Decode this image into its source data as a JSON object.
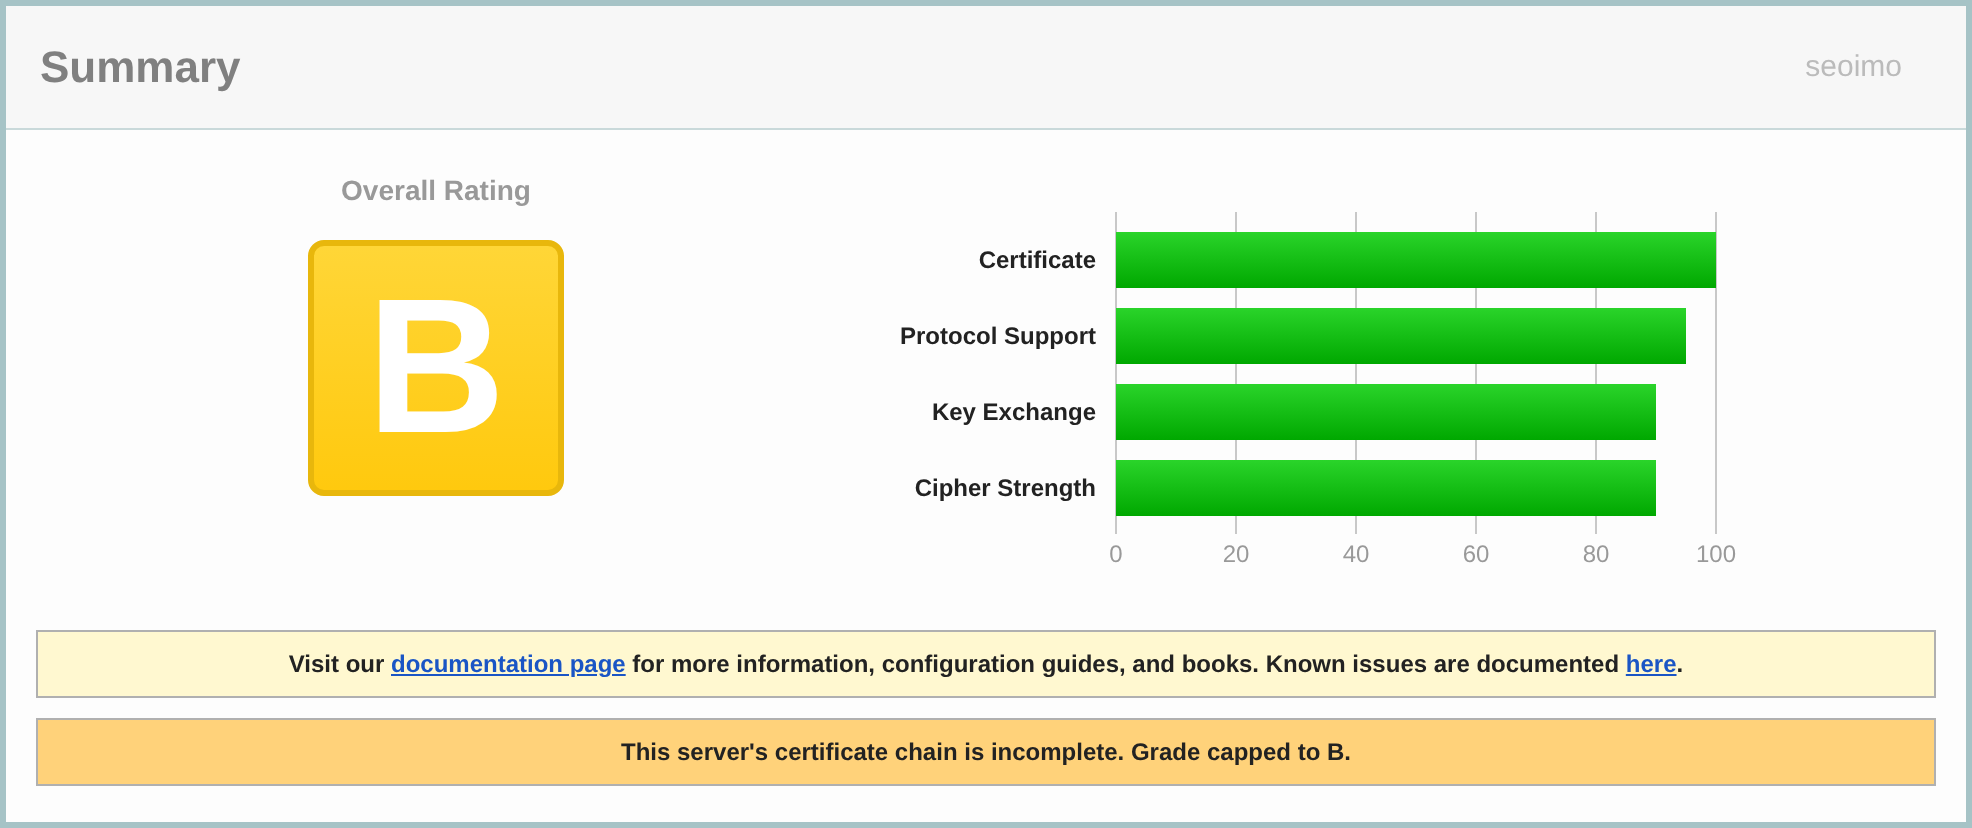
{
  "header": {
    "title": "Summary",
    "brand": "seoimo"
  },
  "rating": {
    "label": "Overall Rating",
    "grade": "B"
  },
  "chart_data": {
    "type": "bar",
    "orientation": "horizontal",
    "categories": [
      "Certificate",
      "Protocol Support",
      "Key Exchange",
      "Cipher Strength"
    ],
    "values": [
      100,
      95,
      90,
      90
    ],
    "xlim": [
      0,
      100
    ],
    "xticks": [
      0,
      20,
      40,
      60,
      80,
      100
    ],
    "grid": true
  },
  "notices": [
    {
      "kind": "info",
      "segments": [
        {
          "kind": "text",
          "text": "Visit our "
        },
        {
          "kind": "link",
          "text": "documentation page"
        },
        {
          "kind": "text",
          "text": " for more information, configuration guides, and books. Known issues are documented "
        },
        {
          "kind": "link",
          "text": "here"
        },
        {
          "kind": "text",
          "text": "."
        }
      ]
    },
    {
      "kind": "warning",
      "segments": [
        {
          "kind": "text",
          "text": "This server's certificate chain is incomplete. Grade capped to B."
        }
      ]
    }
  ]
}
